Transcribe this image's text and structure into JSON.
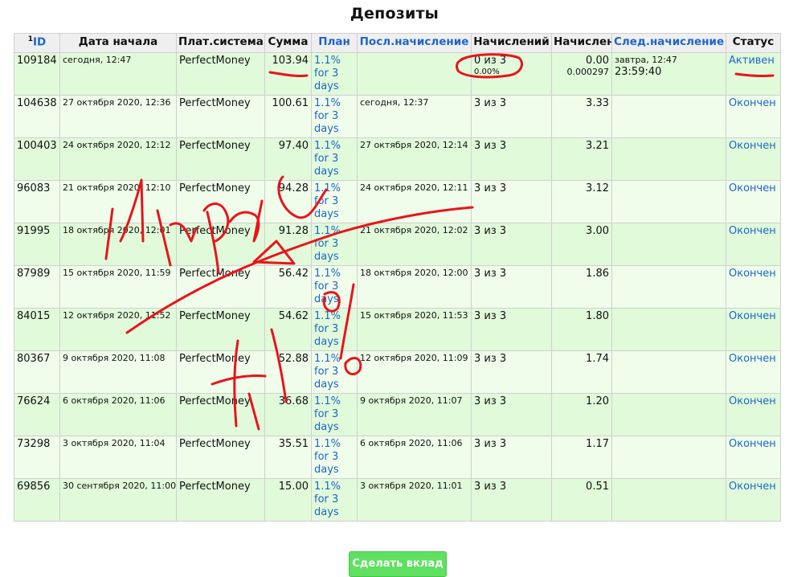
{
  "page": {
    "title": "Депозиты"
  },
  "table": {
    "headers": {
      "id_sup": "1",
      "id": "ID",
      "start_date": "Дата начала",
      "pay_system": "Плат.система",
      "amount": "Сумма",
      "plan": "План",
      "last_accrual": "Посл.начисление",
      "accruals": "Начислений",
      "accrued": "Начислено",
      "next_accrual": "След.начисление",
      "status": "Статус"
    },
    "rows": [
      {
        "id": "109184",
        "start": "сегодня, 12:47",
        "system": "PerfectMoney",
        "amount": "103.94",
        "plan_1": "1.1%",
        "plan_2": "for 3",
        "plan_3": "days",
        "last": "",
        "count": "0 из 3",
        "count_pct": "0.00%",
        "accrued": "0.00",
        "accrued_sub": "0.000297",
        "next": "завтра, 12:47",
        "timer": "23:59:40",
        "status": "Активен"
      },
      {
        "id": "104638",
        "start": "27 октября 2020, 12:36",
        "system": "PerfectMoney",
        "amount": "100.61",
        "plan_1": "1.1%",
        "plan_2": "for 3",
        "plan_3": "days",
        "last": "сегодня, 12:37",
        "count": "3 из 3",
        "count_pct": "",
        "accrued": "3.33",
        "accrued_sub": "",
        "next": "",
        "timer": "",
        "status": "Окончен"
      },
      {
        "id": "100403",
        "start": "24 октября 2020, 12:12",
        "system": "PerfectMoney",
        "amount": "97.40",
        "plan_1": "1.1%",
        "plan_2": "for 3",
        "plan_3": "days",
        "last": "27 октября 2020, 12:14",
        "count": "3 из 3",
        "count_pct": "",
        "accrued": "3.21",
        "accrued_sub": "",
        "next": "",
        "timer": "",
        "status": "Окончен"
      },
      {
        "id": "96083",
        "start": "21 октября 2020, 12:10",
        "system": "PerfectMoney",
        "amount": "94.28",
        "plan_1": "1.1%",
        "plan_2": "for 3",
        "plan_3": "days",
        "last": "24 октября 2020, 12:11",
        "count": "3 из 3",
        "count_pct": "",
        "accrued": "3.12",
        "accrued_sub": "",
        "next": "",
        "timer": "",
        "status": "Окончен"
      },
      {
        "id": "91995",
        "start": "18 октября 2020, 12:01",
        "system": "PerfectMoney",
        "amount": "91.28",
        "plan_1": "1.1%",
        "plan_2": "for 3",
        "plan_3": "days",
        "last": "21 октября 2020, 12:02",
        "count": "3 из 3",
        "count_pct": "",
        "accrued": "3.00",
        "accrued_sub": "",
        "next": "",
        "timer": "",
        "status": "Окончен"
      },
      {
        "id": "87989",
        "start": "15 октября 2020, 11:59",
        "system": "PerfectMoney",
        "amount": "56.42",
        "plan_1": "1.1%",
        "plan_2": "for 3",
        "plan_3": "days",
        "last": "18 октября 2020, 12:00",
        "count": "3 из 3",
        "count_pct": "",
        "accrued": "1.86",
        "accrued_sub": "",
        "next": "",
        "timer": "",
        "status": "Окончен"
      },
      {
        "id": "84015",
        "start": "12 октября 2020, 11:52",
        "system": "PerfectMoney",
        "amount": "54.62",
        "plan_1": "1.1%",
        "plan_2": "for 3",
        "plan_3": "days",
        "last": "15 октября 2020, 11:53",
        "count": "3 из 3",
        "count_pct": "",
        "accrued": "1.80",
        "accrued_sub": "",
        "next": "",
        "timer": "",
        "status": "Окончен"
      },
      {
        "id": "80367",
        "start": "9 октября 2020, 11:08",
        "system": "PerfectMoney",
        "amount": "52.88",
        "plan_1": "1.1%",
        "plan_2": "for 3",
        "plan_3": "days",
        "last": "12 октября 2020, 11:09",
        "count": "3 из 3",
        "count_pct": "",
        "accrued": "1.74",
        "accrued_sub": "",
        "next": "",
        "timer": "",
        "status": "Окончен"
      },
      {
        "id": "76624",
        "start": "6 октября 2020, 11:06",
        "system": "PerfectMoney",
        "amount": "36.68",
        "plan_1": "1.1%",
        "plan_2": "for 3",
        "plan_3": "days",
        "last": "9 октября 2020, 11:07",
        "count": "3 из 3",
        "count_pct": "",
        "accrued": "1.20",
        "accrued_sub": "",
        "next": "",
        "timer": "",
        "status": "Окончен"
      },
      {
        "id": "73298",
        "start": "3 октября 2020, 11:04",
        "system": "PerfectMoney",
        "amount": "35.51",
        "plan_1": "1.1%",
        "plan_2": "for 3",
        "plan_3": "days",
        "last": "6 октября 2020, 11:06",
        "count": "3 из 3",
        "count_pct": "",
        "accrued": "1.17",
        "accrued_sub": "",
        "next": "",
        "timer": "",
        "status": "Окончен"
      },
      {
        "id": "69856",
        "start": "30 сентября 2020, 11:00",
        "system": "PerfectMoney",
        "amount": "15.00",
        "plan_1": "1.1%",
        "plan_2": "for 3",
        "plan_3": "days",
        "last": "3 октября 2020, 11:01",
        "count": "3 из 3",
        "count_pct": "",
        "accrued": "0.51",
        "accrued_sub": "",
        "next": "",
        "timer": "",
        "status": "Окончен"
      }
    ]
  },
  "actions": {
    "make_deposit": "Сделать вклад"
  },
  "colors": {
    "link": "#1e66c8",
    "row_odd": "#e0fada",
    "row_even": "#effdea",
    "button": "#5fe062",
    "scribble": "#e8141c"
  }
}
